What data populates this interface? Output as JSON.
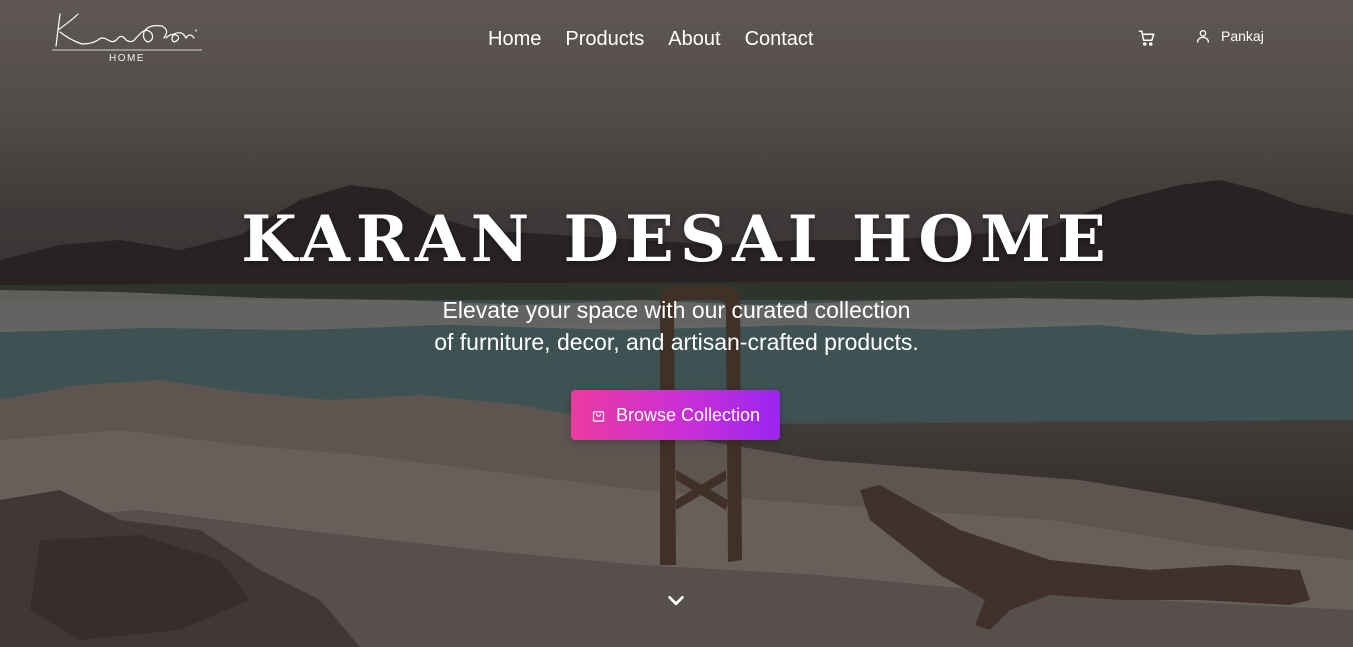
{
  "brand": {
    "logo_signature": "Karan Desai",
    "logo_sub": "HOME"
  },
  "nav": {
    "items": [
      "Home",
      "Products",
      "About",
      "Contact"
    ]
  },
  "header": {
    "cart_icon": "cart-icon",
    "user_icon": "user-icon",
    "user_name": "Pankaj"
  },
  "hero": {
    "title": "KARAN DESAI HOME",
    "subtitle_line1": "Elevate your space with our curated collection",
    "subtitle_line2": "of furniture, decor, and artisan-crafted products.",
    "cta_label": "Browse Collection",
    "cta_icon": "shopping-bag-icon",
    "scroll_icon": "chevron-down-icon"
  },
  "colors": {
    "cta_gradient_start": "#ec3b9e",
    "cta_gradient_end": "#9a25f0",
    "text": "#ffffff"
  }
}
